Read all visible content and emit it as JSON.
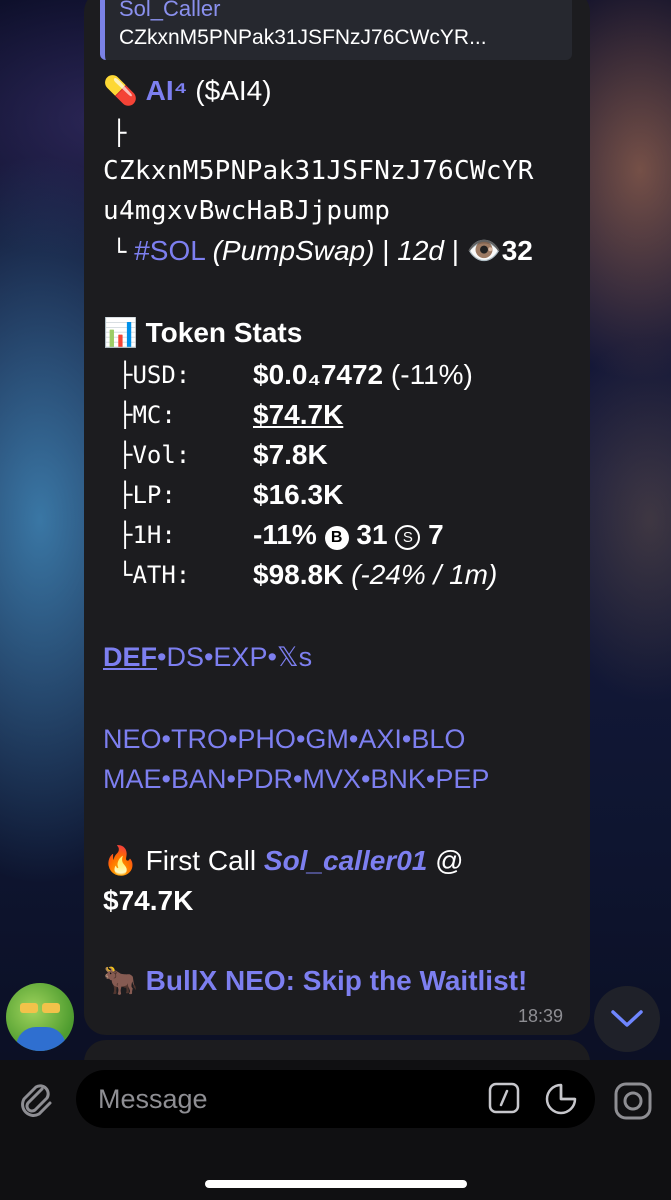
{
  "reply": {
    "name": "Sol_Caller",
    "text": "CZkxnM5PNPak31JSFNzJ76CWcYR..."
  },
  "token": {
    "emoji": "💊",
    "name": "AI⁴",
    "ticker": "($AI4)",
    "tree_branch": "├",
    "address_line1": "CZkxnM5PNPak31JSFNzJ76CWcYR",
    "address_line2": "u4mgxvBwcHaBJjpump",
    "tree_end": "└",
    "chain": "#SOL",
    "dex": "(PumpSwap)",
    "pipe1": "|",
    "age": "12d",
    "pipe2": "|",
    "eye_emoji": "👁️",
    "views": "32"
  },
  "stats": {
    "emoji": "📊",
    "title": "Token Stats",
    "rows": [
      {
        "label": "├USD:",
        "value": "$0.0₄7472",
        "extra": "(-11%)"
      },
      {
        "label": "├MC:",
        "value": "$74.7K",
        "extra": ""
      },
      {
        "label": "├Vol:",
        "value": "$7.8K",
        "extra": ""
      },
      {
        "label": "├LP:",
        "value": "$16.3K",
        "extra": ""
      },
      {
        "label": "├1H:",
        "value": "-11%",
        "extra": ""
      },
      {
        "label": "└ATH:",
        "value": "$98.8K",
        "extra": "(-24% / 1m)"
      }
    ],
    "buys_icon": "B",
    "buys": "31",
    "sells_icon": "S",
    "sells": "7"
  },
  "links1": [
    "DEF",
    "DS",
    "EXP",
    "𝕏s"
  ],
  "links2": [
    "NEO",
    "TRO",
    "PHO",
    "GM",
    "AXI",
    "BLO"
  ],
  "links3": [
    "MAE",
    "BAN",
    "PDR",
    "MVX",
    "BNK",
    "PEP"
  ],
  "separator": "•",
  "first_call": {
    "emoji": "🔥",
    "label": "First Call",
    "caller": "Sol_caller01",
    "at": "@",
    "value": "$74.7K"
  },
  "promo": {
    "emoji": "🐂",
    "text": "BullX NEO: Skip the Waitlist!"
  },
  "time": "18:39",
  "composer": {
    "placeholder": "Message"
  }
}
